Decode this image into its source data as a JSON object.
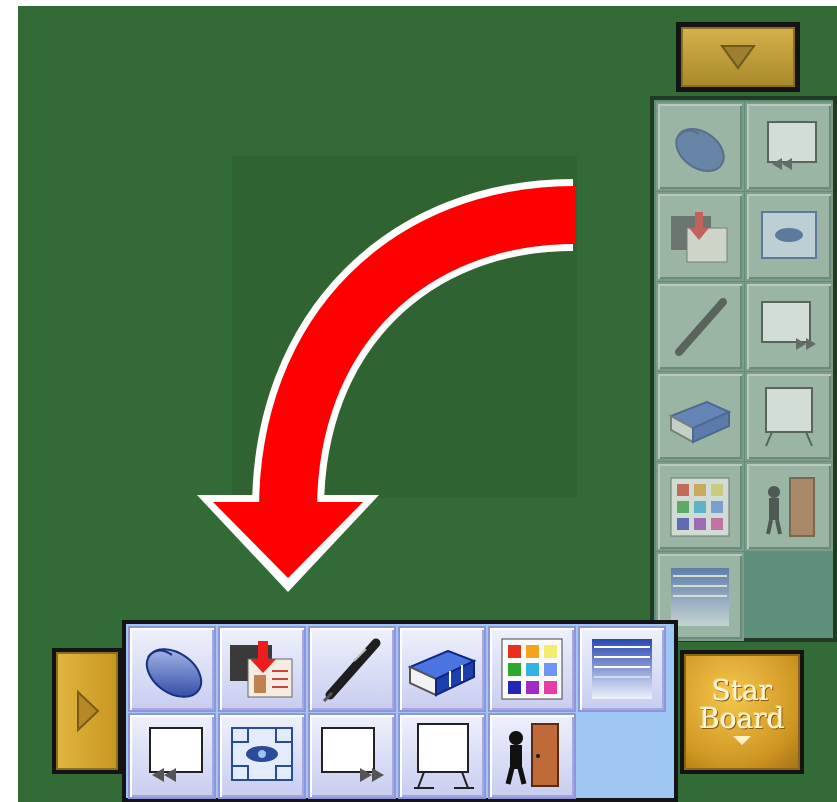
{
  "colors": {
    "board_background": "#336b36",
    "toolbar_button_face": "#c8cdf0",
    "toolbar_panel": "#9ec8f3",
    "gold_button": "#cf9522",
    "arrow": "#ff0000"
  },
  "collapse_button": {
    "icon": "triangle-down-icon"
  },
  "side_toggle": {
    "icon": "triangle-right-icon"
  },
  "starboard_button": {
    "line1": "Star",
    "line2": "Board",
    "icon": "triangle-down-icon"
  },
  "hint_arrow": {
    "icon": "curved-arrow-down-left-icon"
  },
  "toolbar": {
    "row1": [
      {
        "id": "mouse",
        "icon": "mouse-icon"
      },
      {
        "id": "capture-to-page",
        "icon": "capture-to-page-icon"
      },
      {
        "id": "pen",
        "icon": "pen-icon"
      },
      {
        "id": "eraser",
        "icon": "eraser-icon"
      },
      {
        "id": "palette",
        "icon": "color-palette-icon"
      },
      {
        "id": "line-width",
        "icon": "line-width-icon"
      }
    ],
    "row2": [
      {
        "id": "previous-page",
        "icon": "previous-page-icon"
      },
      {
        "id": "screen-view",
        "icon": "screen-view-icon"
      },
      {
        "id": "next-page",
        "icon": "next-page-icon"
      },
      {
        "id": "whiteboard",
        "icon": "whiteboard-icon"
      },
      {
        "id": "exit",
        "icon": "exit-door-icon"
      }
    ]
  }
}
